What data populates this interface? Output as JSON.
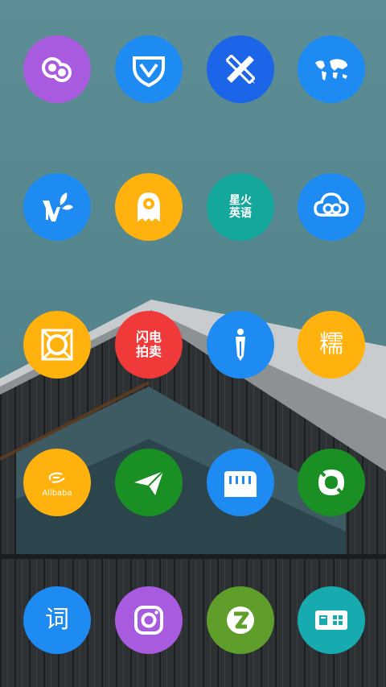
{
  "screen": {
    "type": "android-launcher-home",
    "icon_theme": "flat-circle"
  },
  "colors": {
    "purple": "#a95be0",
    "blue": "#1e8bf2",
    "deep_blue": "#1c64e8",
    "yellow": "#ffb20d",
    "teal": "#14a89c",
    "red": "#f03a3a",
    "green": "#1a8f23",
    "lime_green": "#5f9e2a",
    "sky_teal": "#17abb0"
  },
  "apps": [
    {
      "icon": "chat-heads-icon",
      "color": "purple"
    },
    {
      "icon": "shield-check-icon",
      "color": "blue"
    },
    {
      "icon": "pencil-ruler-icon",
      "color": "deep_blue"
    },
    {
      "icon": "world-map-icon",
      "color": "blue"
    },
    {
      "icon": "v-leaf-icon",
      "color": "blue"
    },
    {
      "icon": "ghost-icon",
      "color": "yellow"
    },
    {
      "icon": "text-icon",
      "label": "星火\n英语",
      "color": "teal"
    },
    {
      "icon": "cloud-icon",
      "color": "blue"
    },
    {
      "icon": "frame-icon",
      "color": "yellow"
    },
    {
      "icon": "text-icon",
      "label": "闪电\n拍卖",
      "color": "red"
    },
    {
      "icon": "pen-nib-icon",
      "color": "blue"
    },
    {
      "icon": "text-icon",
      "label": "糯",
      "color": "yellow"
    },
    {
      "icon": "alibaba-logo-icon",
      "label": "Alibaba",
      "color": "yellow"
    },
    {
      "icon": "paper-plane-icon",
      "color": "green"
    },
    {
      "icon": "bus-icon",
      "color": "blue"
    },
    {
      "icon": "ring-icon",
      "color": "green"
    },
    {
      "icon": "text-icon",
      "label": "词",
      "color": "blue"
    },
    {
      "icon": "instagram-icon",
      "color": "purple"
    },
    {
      "icon": "z-logo-icon",
      "color": "lime_green"
    },
    {
      "icon": "map-card-icon",
      "color": "sky_teal"
    }
  ]
}
